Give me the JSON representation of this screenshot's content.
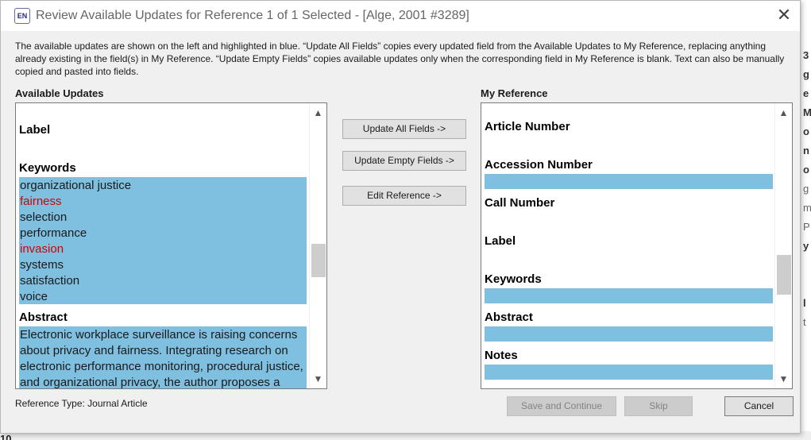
{
  "window": {
    "icon_text": "EN",
    "title": "Review Available Updates for Reference 1 of 1 Selected - [Alge, 2001 #3289]",
    "close_glyph": "✕"
  },
  "description": "The available updates are shown on the left and highlighted in blue. “Update All Fields” copies every updated field from the Available Updates to My Reference, replacing anything already existing in the field(s) in My Reference. “Update Empty Fields” copies available updates only when the corresponding field in My Reference is blank. Text can also be manually copied and pasted into fields.",
  "available_updates": {
    "heading": "Available Updates",
    "label_field": "Label",
    "keywords_field": "Keywords",
    "keywords": [
      {
        "text": "organizational justice",
        "color": "#1a1a1a"
      },
      {
        "text": "fairness",
        "color": "#d40000"
      },
      {
        "text": "selection",
        "color": "#1a1a1a"
      },
      {
        "text": "performance",
        "color": "#1a1a1a"
      },
      {
        "text": "invasion",
        "color": "#d40000"
      },
      {
        "text": "systems",
        "color": "#1a1a1a"
      },
      {
        "text": "satisfaction",
        "color": "#1a1a1a"
      },
      {
        "text": "voice",
        "color": "#1a1a1a"
      }
    ],
    "abstract_field": "Abstract",
    "abstract_lines": [
      "Electronic workplace surveillance is raising concerns",
      "about privacy and fairness. Integrating research on",
      "electronic performance monitoring, procedural justice,",
      "and organizational privacy, the author proposes a"
    ]
  },
  "my_reference": {
    "heading": "My Reference",
    "fields": [
      "Article Number",
      "Accession Number",
      "Call Number",
      "Label",
      "Keywords",
      "Abstract",
      "Notes"
    ]
  },
  "buttons": {
    "update_all": "Update All Fields ->",
    "update_empty": "Update Empty Fields ->",
    "edit_reference": "Edit Reference ->",
    "save_continue": "Save and Continue",
    "skip": "Skip",
    "cancel": "Cancel"
  },
  "reference_type": "Reference Type: Journal Article",
  "scroll": {
    "up_glyph": "▲",
    "down_glyph": "▼"
  },
  "colors": {
    "highlight": "#7fbfdf",
    "changed_keyword": "#d40000"
  },
  "background_window": {
    "glyphs": [
      "3",
      "g",
      "e",
      "M",
      "o",
      "n",
      "o",
      "g",
      "m",
      "P",
      "y",
      "l",
      "t"
    ],
    "bottom_text": "10"
  }
}
